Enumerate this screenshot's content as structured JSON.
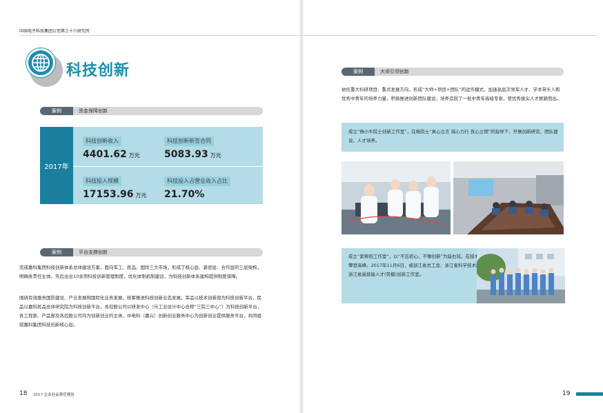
{
  "header": {
    "running_head": "中国电子科技集团公司第三十六研究所"
  },
  "left": {
    "title": "科技创新",
    "case1": {
      "tag": "案例",
      "title": "资金保障创新"
    },
    "stats": {
      "year": "2017年",
      "items": [
        {
          "label": "科技创新收入",
          "value": "4401.62",
          "unit": "万元"
        },
        {
          "label": "科技创新新签合同",
          "value": "5083.93",
          "unit": "万元"
        },
        {
          "label": "科技投入规模",
          "value": "17153.96",
          "unit": "万元"
        },
        {
          "label": "科技投入占营业收入占比",
          "value": "21.70%",
          "unit": ""
        }
      ]
    },
    "case2": {
      "tag": "案例",
      "title": "平台支撑创新"
    },
    "paragraphs": [
      "完成嘉科集团科技创新体系总体建设方案，面向军工、民品、国际三大市场，形成了核心层、紧密层、合作层的三层架构，明确各责任主体。先后出台10余项科技创新管理制度，优化体制机制建设，为科技创新体系建构提供制度保障。",
      "围绕有效服务国防建设、产业发展和国际化业务发展，统筹推进科技创新业态发展。军品以技术创新部为科技创新平台，民品以嘉科民品总体研究院为科技创新平台，各控股公司以研发中心（与工业设计中心合称“三院三中心”）为科技创新平台，各工程部、产品部及各控股公司均为创新创业的主体，中电科（嘉兴）创新创业服务中心为创新创业提供服务平台，共同组成嘉科集团科技创新核心层。"
    ],
    "footer": {
      "page_number": "18",
      "report_name": "2017 企业社会责任报告"
    }
  },
  "right": {
    "case": {
      "tag": "案例",
      "title": "大师引领创新"
    },
    "intro": "依托重大科研项目、重点发展方向，形成“大师+项目+团队”的运作模式，加速高层次领军人才、学术带头人和优秀中青年的培养力量，积极推进创新团队建设，培养造就了一批中青年高级专家，使优秀拔尖人才脱颖而出。",
    "box1": "成立“杨小牛院士创新工作室”，在杨院士“真心立言 诚心力行 良心立德”的指导下，开展创新研究、团队建设、人才培养。",
    "box2": "成立“紫柳阳工作室”，以“不忘初心、不懈创新”为座右铭，在技术创新领域不断攀登高峰。2017年11月6日，被浙江省总工会、浙江省科学技术厅命名为第七批浙江省高技能人才(劳模)创新工作室。",
    "footer": {
      "page_number": "19"
    }
  },
  "colors": {
    "brand_blue": "#1a8fab",
    "deep_blue": "#1a7f9e",
    "panel_blue": "#b3dce7",
    "tag_gray": "#5b6770"
  },
  "icons": {
    "logo": "globe-icon"
  }
}
